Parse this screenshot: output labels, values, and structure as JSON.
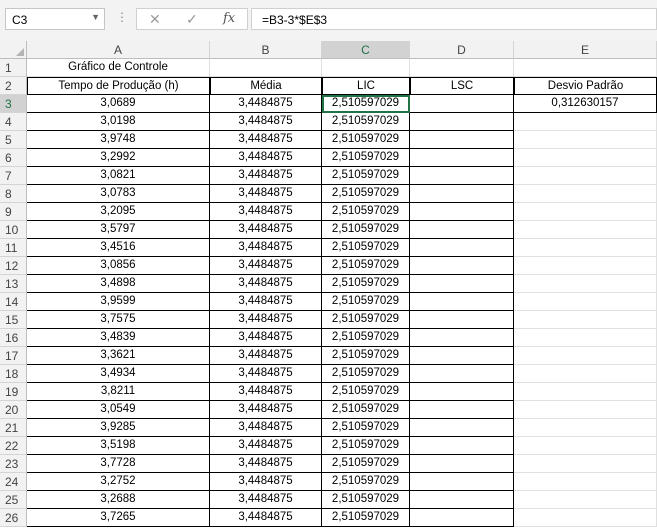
{
  "name_box": "C3",
  "formula": "=B3-3*$E$3",
  "columns": [
    "A",
    "B",
    "C",
    "D",
    "E"
  ],
  "rows": [
    "1",
    "2",
    "3",
    "4",
    "5",
    "6",
    "7",
    "8",
    "9",
    "10",
    "11",
    "12",
    "13",
    "14",
    "15",
    "16",
    "17",
    "18",
    "19",
    "20",
    "21",
    "22",
    "23",
    "24",
    "25",
    "26"
  ],
  "title": "Gráfico de Controle",
  "headers": {
    "A": "Tempo de Produção (h)",
    "B": "Média",
    "C": "LIC",
    "D": "LSC",
    "E": "Desvio Padrão"
  },
  "desvio_padrao": "0,312630157",
  "data": [
    {
      "a": "3,0689",
      "b": "3,4484875",
      "c": "2,510597029"
    },
    {
      "a": "3,0198",
      "b": "3,4484875",
      "c": "2,510597029"
    },
    {
      "a": "3,9748",
      "b": "3,4484875",
      "c": "2,510597029"
    },
    {
      "a": "3,2992",
      "b": "3,4484875",
      "c": "2,510597029"
    },
    {
      "a": "3,0821",
      "b": "3,4484875",
      "c": "2,510597029"
    },
    {
      "a": "3,0783",
      "b": "3,4484875",
      "c": "2,510597029"
    },
    {
      "a": "3,2095",
      "b": "3,4484875",
      "c": "2,510597029"
    },
    {
      "a": "3,5797",
      "b": "3,4484875",
      "c": "2,510597029"
    },
    {
      "a": "3,4516",
      "b": "3,4484875",
      "c": "2,510597029"
    },
    {
      "a": "3,0856",
      "b": "3,4484875",
      "c": "2,510597029"
    },
    {
      "a": "3,4898",
      "b": "3,4484875",
      "c": "2,510597029"
    },
    {
      "a": "3,9599",
      "b": "3,4484875",
      "c": "2,510597029"
    },
    {
      "a": "3,7575",
      "b": "3,4484875",
      "c": "2,510597029"
    },
    {
      "a": "3,4839",
      "b": "3,4484875",
      "c": "2,510597029"
    },
    {
      "a": "3,3621",
      "b": "3,4484875",
      "c": "2,510597029"
    },
    {
      "a": "3,4934",
      "b": "3,4484875",
      "c": "2,510597029"
    },
    {
      "a": "3,8211",
      "b": "3,4484875",
      "c": "2,510597029"
    },
    {
      "a": "3,0549",
      "b": "3,4484875",
      "c": "2,510597029"
    },
    {
      "a": "3,9285",
      "b": "3,4484875",
      "c": "2,510597029"
    },
    {
      "a": "3,5198",
      "b": "3,4484875",
      "c": "2,510597029"
    },
    {
      "a": "3,7728",
      "b": "3,4484875",
      "c": "2,510597029"
    },
    {
      "a": "3,2752",
      "b": "3,4484875",
      "c": "2,510597029"
    },
    {
      "a": "3,2688",
      "b": "3,4484875",
      "c": "2,510597029"
    },
    {
      "a": "3,7265",
      "b": "3,4484875",
      "c": "2,510597029"
    }
  ],
  "icons": {
    "cancel": "cancel-icon",
    "enter": "enter-icon",
    "function": "function-icon"
  }
}
